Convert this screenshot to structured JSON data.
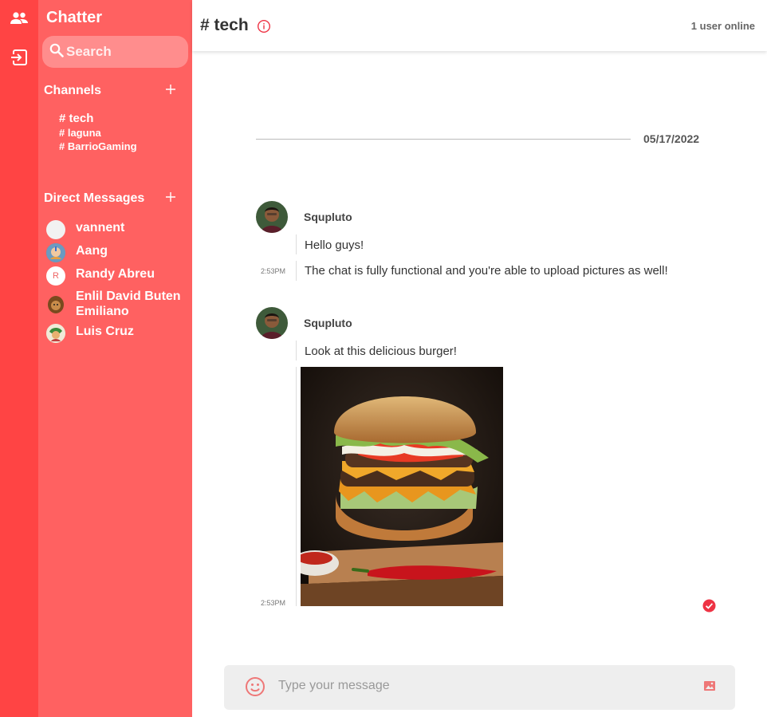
{
  "app": {
    "title": "Chatter"
  },
  "sidebar": {
    "search_placeholder": "Search",
    "channels_title": "Channels",
    "channels": [
      {
        "label": "# tech",
        "active": true
      },
      {
        "label": "# laguna",
        "active": false
      },
      {
        "label": "# BarrioGaming",
        "active": false
      }
    ],
    "dm_title": "Direct Messages",
    "direct_messages": [
      {
        "name": "vannent",
        "avatar": "blank"
      },
      {
        "name": "Aang",
        "avatar": "photo"
      },
      {
        "name": "Randy Abreu",
        "avatar": "initial",
        "initial": "R"
      },
      {
        "name": "Enlil David Buten Emiliano",
        "avatar": "photo"
      },
      {
        "name": "Luis Cruz",
        "avatar": "photo"
      }
    ]
  },
  "header": {
    "channel_title": "# tech",
    "online_status": "1 user online"
  },
  "messages": {
    "date": "05/17/2022",
    "groups": [
      {
        "author": "Squpluto",
        "messages": [
          {
            "text": "Hello guys!",
            "time": ""
          },
          {
            "text": "The chat is fully functional and you're able to upload pictures as well!",
            "time": "2:53PM"
          }
        ]
      },
      {
        "author": "Squpluto",
        "messages": [
          {
            "text": "Look at this delicious burger!",
            "time": ""
          },
          {
            "image": "burger-photo",
            "time": "2:53PM"
          }
        ]
      }
    ]
  },
  "composer": {
    "placeholder": "Type your message"
  },
  "colors": {
    "rail": "#ff4444",
    "sidebar": "#ff6161",
    "accent": "#ee3344"
  }
}
